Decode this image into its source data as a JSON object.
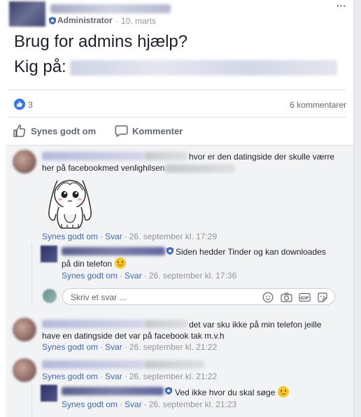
{
  "post": {
    "role_label": "Administrator",
    "date": "10. marts",
    "more_icon": "more-dots-icon",
    "text_line1": "Brug for admins hjælp?",
    "text_line2_prefix": "Kig på:",
    "like_count": "3",
    "comments_count": "6 kommentarer"
  },
  "actions": {
    "like_label": "Synes godt om",
    "comment_label": "Kommenter"
  },
  "comments": [
    {
      "text_line1": "hvor er den datingside der skulle værre",
      "text_line2": "her på facebookmed venlighilsen",
      "like": "Synes godt om",
      "reply": "Svar",
      "time": "26. september kl. 17:29"
    },
    {
      "text_line1": "det var sku ikke på min telefon jeille",
      "text_line2": "have en datingside det var på facebook tak m.v.h",
      "like": "Synes godt om",
      "reply": "Svar",
      "time": "26. september kl. 21:22"
    },
    {
      "like": "Synes godt om",
      "reply": "Svar",
      "time": "26. september kl. 21:22"
    }
  ],
  "replies": [
    {
      "text_line1": "Siden hedder Tinder og kan downloades",
      "text_line2": "på din telefon",
      "like": "Synes godt om",
      "reply": "Svar",
      "time": "26. september kl. 17:36"
    },
    {
      "text_line1": "Ved ikke hvor du skal søge",
      "like": "Synes godt om",
      "reply": "Svar",
      "time": "26. september kl. 21:23"
    }
  ],
  "reply_input": {
    "placeholder": "Skriv et svar ..."
  },
  "colors": {
    "link": "#4267b2",
    "meta": "#90949c",
    "like_blue": "#3578e5",
    "comments_bg": "#f2f3f5"
  }
}
